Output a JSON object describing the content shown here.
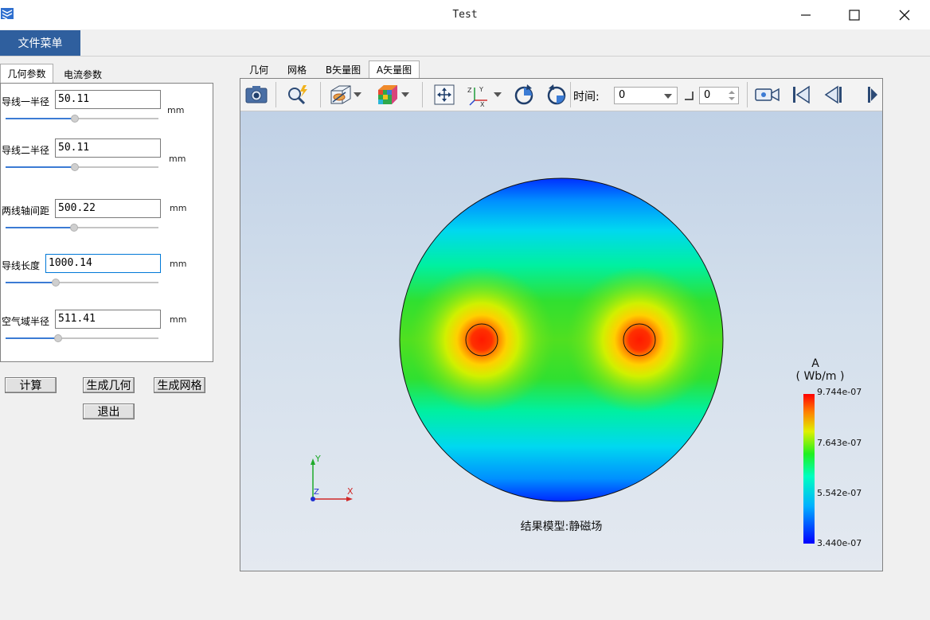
{
  "window": {
    "title": "Test",
    "minimize_icon": "minimize-icon",
    "maximize_icon": "maximize-icon",
    "close_icon": "close-icon"
  },
  "menu": {
    "file_menu": "文件菜单"
  },
  "left_tabs": [
    {
      "label": "几何参数",
      "active": true
    },
    {
      "label": "电流参数",
      "active": false
    }
  ],
  "fields": [
    {
      "label": "导线一半径",
      "value": "50.11",
      "unit": "mm",
      "slider_fraction": 0.45
    },
    {
      "label": "导线二半径",
      "value": "50.11",
      "unit": "mm",
      "slider_fraction": 0.45
    },
    {
      "label": "两线轴间距",
      "value": "500.22",
      "unit": "mm",
      "slider_fraction": 0.44
    },
    {
      "label": "导线长度",
      "value": "1000.14",
      "unit": "mm",
      "slider_fraction": 0.32,
      "focused": true
    },
    {
      "label": "空气域半径",
      "value": "511.41",
      "unit": "mm",
      "slider_fraction": 0.34
    }
  ],
  "buttons": {
    "compute": "计算",
    "gen_geometry": "生成几何",
    "gen_mesh": "生成网格",
    "exit": "退出"
  },
  "viewer_tabs": [
    {
      "label": "几何",
      "active": false
    },
    {
      "label": "网格",
      "active": false
    },
    {
      "label": "B矢量图",
      "active": false
    },
    {
      "label": "A矢量图",
      "active": true
    }
  ],
  "toolbar": {
    "icons": [
      "camera-icon",
      "probe-icon",
      "display-mode-icon",
      "color-cube-icon",
      "fit-view-icon",
      "axes-orientation-icon",
      "rotate-cw-icon",
      "rotate-ccw-icon",
      "record-camera-icon",
      "first-frame-icon",
      "prev-frame-icon",
      "next-frame-icon"
    ],
    "time_label": "时间:",
    "time_value": "0",
    "step_value": "0"
  },
  "plot": {
    "legend_title": "A",
    "legend_unit": "( Wb/m )",
    "legend_ticks": [
      "9.744e-07",
      "7.643e-07",
      "5.542e-07",
      "3.440e-07"
    ],
    "axis_x": "X",
    "axis_y": "Y",
    "axis_z": "Z",
    "result_label": "结果模型:静磁场",
    "colors": {
      "low": "#0000ff",
      "high": "#ff0000"
    }
  }
}
